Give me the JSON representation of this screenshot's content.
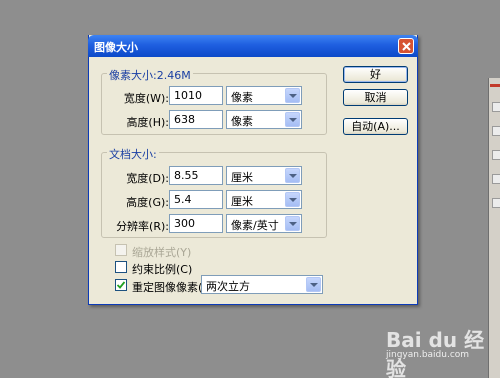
{
  "dialog": {
    "title": "图像大小",
    "pixel_dimensions": {
      "legend": "像素大小:2.46M",
      "width": {
        "label": "宽度(W):",
        "value": "1010",
        "unit": "像素"
      },
      "height": {
        "label": "高度(H):",
        "value": "638",
        "unit": "像素"
      }
    },
    "document_size": {
      "legend": "文档大小:",
      "width": {
        "label": "宽度(D):",
        "value": "8.55",
        "unit": "厘米"
      },
      "height": {
        "label": "高度(G):",
        "value": "5.4",
        "unit": "厘米"
      },
      "resolution": {
        "label": "分辨率(R):",
        "value": "300",
        "unit": "像素/英寸"
      }
    },
    "buttons": {
      "ok": "好",
      "cancel": "取消",
      "auto": "自动(A)..."
    },
    "options": {
      "scale_styles": {
        "label": "缩放样式(Y)",
        "checked": false,
        "enabled": false
      },
      "constrain_proportions": {
        "label": "约束比例(C)",
        "checked": false,
        "enabled": true
      },
      "resample": {
        "label": "重定图像像素(I):",
        "checked": true,
        "method": "两次立方"
      }
    }
  },
  "watermark": {
    "text": "Bai du 经验",
    "url": "jingyan.baidu.com"
  },
  "colors": {
    "titlebar": "#0c49c8",
    "dialog_bg": "#ece9d8",
    "group_label": "#1a3fa3",
    "desktop": "#8e8e8e"
  }
}
